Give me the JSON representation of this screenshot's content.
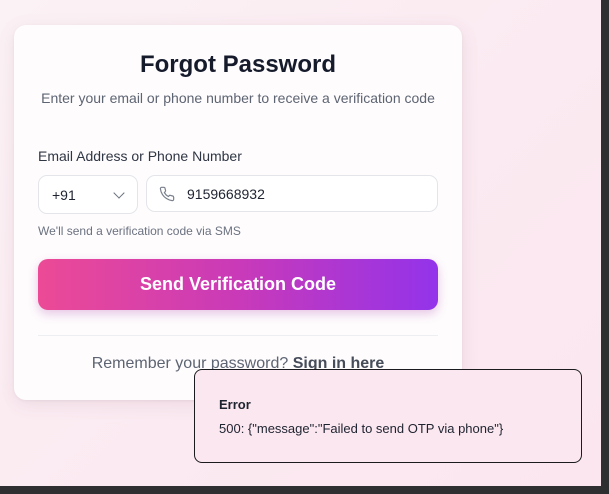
{
  "form": {
    "title": "Forgot Password",
    "subtitle": "Enter your email or phone number to receive a verification code",
    "field_label": "Email Address or Phone Number",
    "country_code": "+91",
    "phone_value": "9159668932",
    "hint": "We'll send a verification code via SMS",
    "submit_label": "Send Verification Code",
    "footer_text": "Remember your password?",
    "footer_link": "Sign in here"
  },
  "toast": {
    "title": "Error",
    "message": "500: {\"message\":\"Failed to send OTP via phone\"}"
  },
  "icons": {
    "country_dropdown": "chevron-down-icon",
    "phone_field": "phone-icon"
  },
  "colors": {
    "button_gradient_start": "#ec4a96",
    "button_gradient_end": "#9333ea",
    "title": "#161b2c"
  }
}
